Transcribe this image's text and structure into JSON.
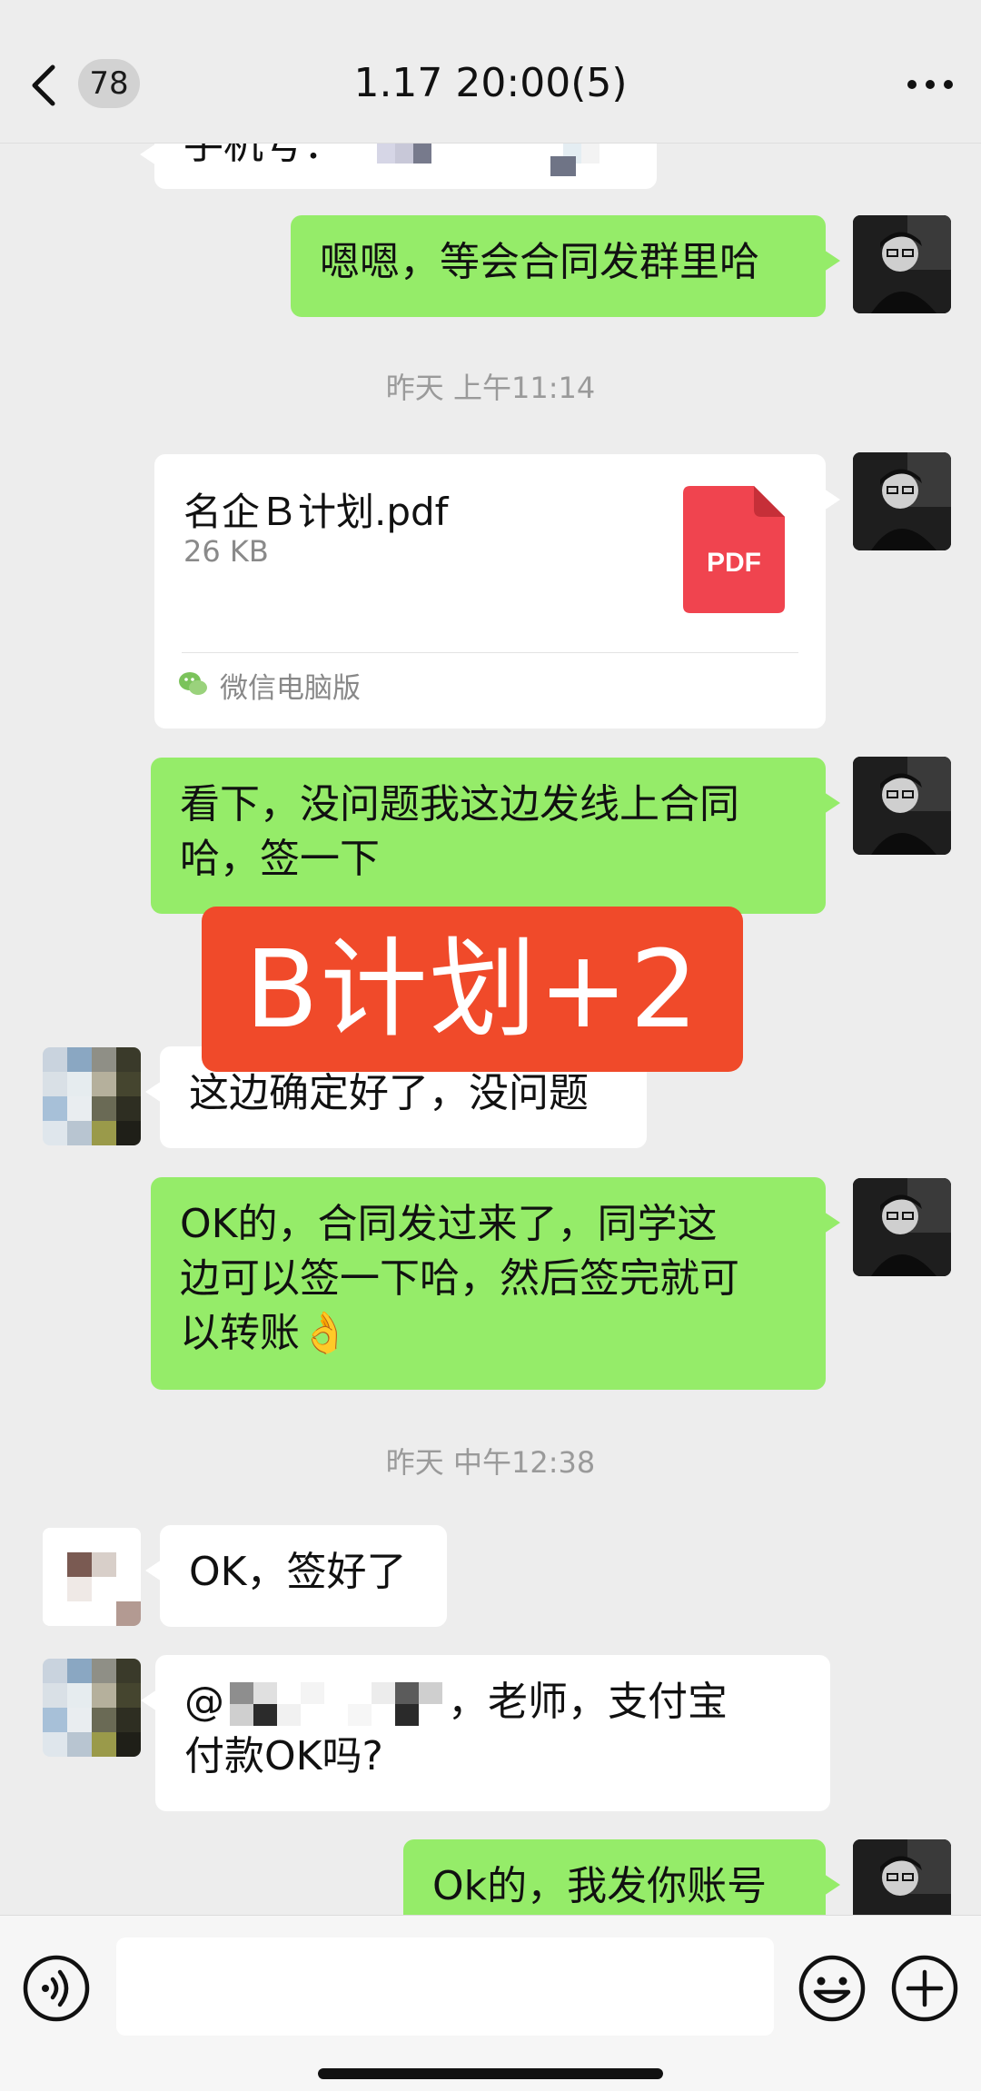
{
  "header": {
    "unread_count": "78",
    "title": "1.17 20:00(5)"
  },
  "messages": {
    "m0_partial": "手机号：",
    "m1": "嗯嗯，等会合同发群里哈",
    "ts1": "昨天 上午11:14",
    "file": {
      "name": "名企Ｂ计划.pdf",
      "size": "26 KB",
      "badge": "PDF",
      "source": "微信电脑版"
    },
    "m2_line1": "看下，没问题我这边发线上合同",
    "m2_line2": "哈，签一下",
    "m3": "这边确定好了，没问题",
    "m4_line1": "OK的，合同发过来了，同学这",
    "m4_line2": "边可以签一下哈，然后签完就可",
    "m4_line3": "以转账",
    "m4_emoji": "👌",
    "ts2": "昨天 中午12:38",
    "m5": "OK，签好了",
    "m6_prefix": "@",
    "m6_suffix": "，老师，支付宝",
    "m6_line2": "付款OK吗?",
    "m7": "Ok的，我发你账号"
  },
  "overlay": {
    "banner_text": "B计划+2"
  },
  "colors": {
    "background": "#ededed",
    "bubble_mine": "#95ec69",
    "bubble_other": "#ffffff",
    "banner": "#f04a2a",
    "pdf_red": "#f0444f"
  }
}
